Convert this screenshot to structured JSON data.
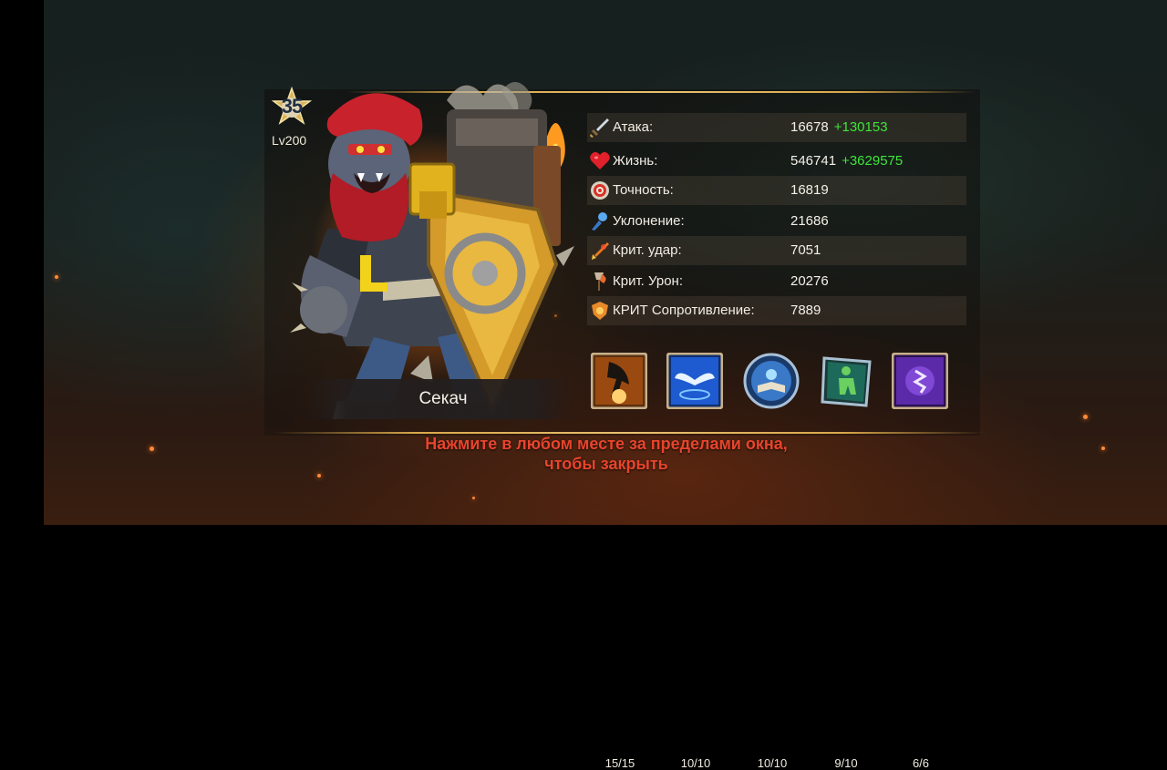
{
  "hero": {
    "level_badge": "35",
    "level_label": "Lv200",
    "name": "Секач"
  },
  "stats": [
    {
      "icon": "sword-icon",
      "label": "Атака:",
      "value": "16678",
      "bonus": "+130153"
    },
    {
      "icon": "heart-icon",
      "label": "Жизнь:",
      "value": "546741",
      "bonus": "+3629575"
    },
    {
      "icon": "target-icon",
      "label": "Точность:",
      "value": "16819",
      "bonus": ""
    },
    {
      "icon": "evasion-icon",
      "label": "Уклонение:",
      "value": "21686",
      "bonus": ""
    },
    {
      "icon": "crit-strike-icon",
      "label": "Крит. удар:",
      "value": "7051",
      "bonus": ""
    },
    {
      "icon": "crit-damage-icon",
      "label": "Крит. Урон:",
      "value": "20276",
      "bonus": ""
    },
    {
      "icon": "crit-resist-icon",
      "label": "КРИТ Сопротивление:",
      "value": "7889",
      "bonus": ""
    }
  ],
  "skills": [
    {
      "icon": "axe-strike-skill-icon",
      "level": "15/15"
    },
    {
      "icon": "winged-aura-skill-icon",
      "level": "10/10"
    },
    {
      "icon": "book-skill-icon",
      "level": "10/10"
    },
    {
      "icon": "silhouette-skill-icon",
      "level": "9/10"
    },
    {
      "icon": "rune-skill-icon",
      "level": "6/6"
    }
  ],
  "close_hint": {
    "line1": "Нажмите в любом месте за пределами окна,",
    "line2": "чтобы закрыть"
  },
  "colors": {
    "bonus": "#3fe43a",
    "hint": "#e8442c",
    "accent_gold": "#d9a84a"
  }
}
